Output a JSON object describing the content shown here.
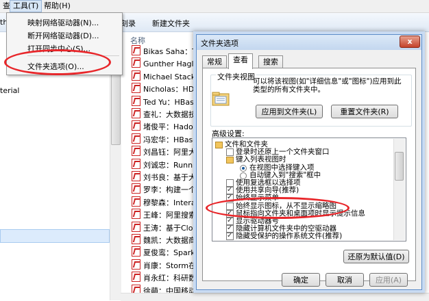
{
  "menubar": {
    "tools": "工具(T)",
    "help": "帮助(H)",
    "left_cut": "查"
  },
  "toolbar": {
    "left_cut": "th",
    "burn": "刻录",
    "new_folder": "新建文件夹"
  },
  "leftpane": {
    "partial_label": "terial"
  },
  "filelist": {
    "column_name": "名称",
    "items": [
      "Bikas Saha：Th",
      "Gunther Hagleit",
      "Michael Stack：",
      "Nicholas：HDFS",
      "Ted Yu：HBase",
      "查礼：大数据技术",
      "堵俊平：Hadoo",
      "冯宏华：HBase存",
      "刘昌钰：阿里大数",
      "刘诚忠：Running",
      "刘书良：基于大数",
      "罗李：构建一个跨",
      "穆黎森：Interac",
      "王峰：阿里搜索",
      "王涛：基于Cloud",
      "魏凯：大数据商",
      "夏俊鸾：Spark-",
      "肖康：Storm在美",
      "肖永红：科研数",
      "徐萌：中国移动大"
    ]
  },
  "dropdown": {
    "map_drive": "映射网络驱动器(N)...",
    "disconnect_drive": "断开网络驱动器(D)...",
    "open_sync": "打开同步中心(S)...",
    "folder_options": "文件夹选项(O)..."
  },
  "dialog": {
    "title": "文件夹选项",
    "close": "x",
    "tabs": [
      "常规",
      "查看",
      "搜索"
    ],
    "folder_view": {
      "group_title": "文件夹视图",
      "description": "可以将该视图(如\"详细信息\"或\"图标\")应用到此类型的所有文件夹中。",
      "apply_button": "应用到文件夹(L)",
      "reset_button": "重置文件夹(R)"
    },
    "advanced_title": "高级设置:",
    "settings": [
      {
        "label": "文件和文件夹",
        "kind": "folder",
        "checked": false
      },
      {
        "label": "登录时还原上一个文件夹窗口",
        "kind": "checkbox",
        "checked": false
      },
      {
        "label": "键入列表视图时",
        "kind": "folder",
        "checked": false
      },
      {
        "label": "在视图中选择键入项",
        "kind": "radio",
        "checked": true
      },
      {
        "label": "自动键入到\"搜索\"框中",
        "kind": "radio",
        "checked": false
      },
      {
        "label": "使用复选框以选择项",
        "kind": "checkbox",
        "checked": false
      },
      {
        "label": "使用共享向导(推荐)",
        "kind": "checkbox",
        "checked": true
      },
      {
        "label": "始终显示菜单",
        "kind": "checkbox",
        "checked": true
      },
      {
        "label": "始终显示图标，从不显示缩略图",
        "kind": "checkbox",
        "checked": false
      },
      {
        "label": "鼠标指向文件夹和桌面项时显示提示信息",
        "kind": "checkbox",
        "checked": true
      },
      {
        "label": "显示驱动器号",
        "kind": "checkbox",
        "checked": true
      },
      {
        "label": "隐藏计算机文件夹中的空驱动器",
        "kind": "checkbox",
        "checked": true
      },
      {
        "label": "隐藏受保护的操作系统文件(推荐)",
        "kind": "checkbox",
        "checked": true
      }
    ],
    "restore_defaults": "还原为默认值(D)",
    "ok": "确定",
    "cancel": "取消",
    "apply": "应用(A)"
  },
  "colors": {
    "annotation": "#e8262a",
    "selection": "#dcebfc",
    "pdf": "#cc2222"
  }
}
